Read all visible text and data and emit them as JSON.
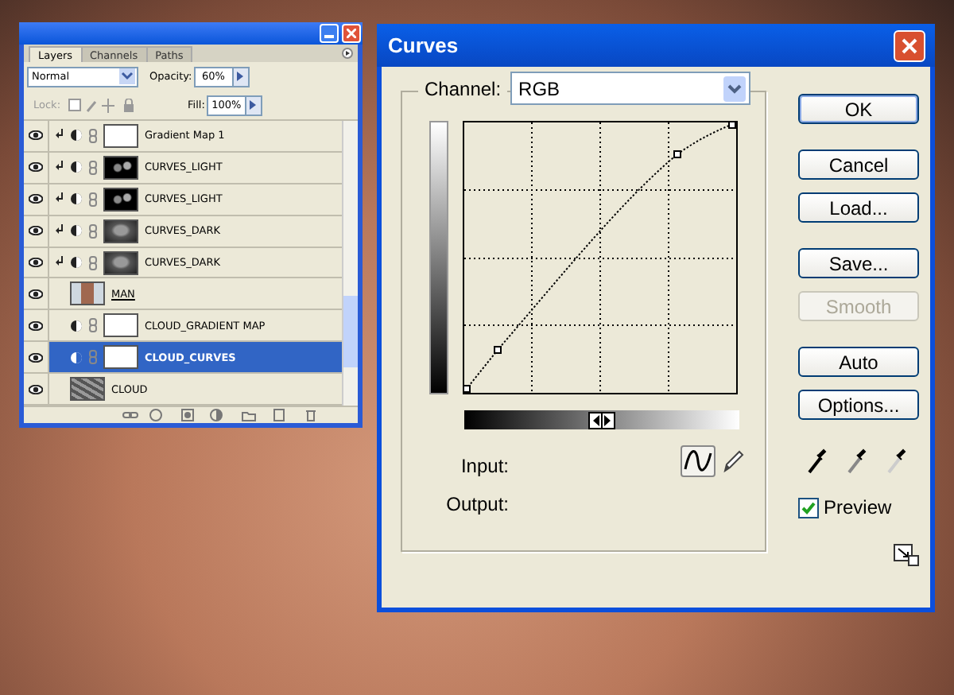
{
  "layers_panel": {
    "tabs": [
      {
        "label": "Layers",
        "selected": true
      },
      {
        "label": "Channels",
        "selected": false
      },
      {
        "label": "Paths",
        "selected": false
      }
    ],
    "blend_mode": "Normal",
    "opacity_label": "Opacity:",
    "opacity": "60%",
    "lock_label": "Lock:",
    "fill_label": "Fill:",
    "fill": "100%",
    "layers": [
      {
        "name": "Gradient Map 1",
        "kind": "adjustment",
        "thumbnail": {
          "kind": "white"
        },
        "clipped": true,
        "underlined": false,
        "visible": true,
        "selected": false
      },
      {
        "name": "CURVES_LIGHT",
        "kind": "adjustment",
        "thumbnail": {
          "kind": "shapes"
        },
        "clipped": true,
        "underlined": false,
        "visible": true,
        "selected": false
      },
      {
        "name": "CURVES_LIGHT",
        "kind": "adjustment",
        "thumbnail": {
          "kind": "shapes"
        },
        "clipped": true,
        "underlined": false,
        "visible": true,
        "selected": false
      },
      {
        "name": "CURVES_DARK",
        "kind": "adjustment",
        "thumbnail": {
          "kind": "gray"
        },
        "clipped": true,
        "underlined": false,
        "visible": true,
        "selected": false
      },
      {
        "name": "CURVES_DARK",
        "kind": "adjustment",
        "thumbnail": {
          "kind": "gray"
        },
        "clipped": true,
        "underlined": false,
        "visible": true,
        "selected": false
      },
      {
        "name": "MAN",
        "kind": "image",
        "thumbnail": {
          "kind": "photo"
        },
        "clipped": false,
        "underlined": true,
        "visible": true,
        "selected": false
      },
      {
        "name": "CLOUD_GRADIENT MAP",
        "kind": "adjustment",
        "thumbnail": {
          "kind": "white"
        },
        "clipped": false,
        "underlined": false,
        "visible": true,
        "selected": false
      },
      {
        "name": "CLOUD_CURVES",
        "kind": "adjustment",
        "thumbnail": {
          "kind": "white"
        },
        "clipped": false,
        "underlined": false,
        "visible": true,
        "selected": true
      },
      {
        "name": "CLOUD",
        "kind": "image",
        "thumbnail": {
          "kind": "texture"
        },
        "clipped": false,
        "underlined": false,
        "visible": true,
        "selected": false
      }
    ]
  },
  "curves_dialog": {
    "title": "Curves",
    "channel_label": "Channel:",
    "channel": "RGB",
    "input_label": "Input:",
    "output_label": "Output:",
    "buttons": [
      {
        "label": "OK",
        "default": true,
        "disabled": false
      },
      {
        "label": "Cancel",
        "default": false,
        "disabled": false
      },
      {
        "label": "Load...",
        "default": false,
        "disabled": false
      },
      {
        "label": "Save...",
        "default": false,
        "disabled": false
      },
      {
        "label": "Smooth",
        "default": false,
        "disabled": true
      },
      {
        "label": "Auto",
        "default": false,
        "disabled": false
      },
      {
        "label": "Options...",
        "default": false,
        "disabled": false
      }
    ],
    "preview": {
      "label": "Preview",
      "checked": true
    }
  }
}
